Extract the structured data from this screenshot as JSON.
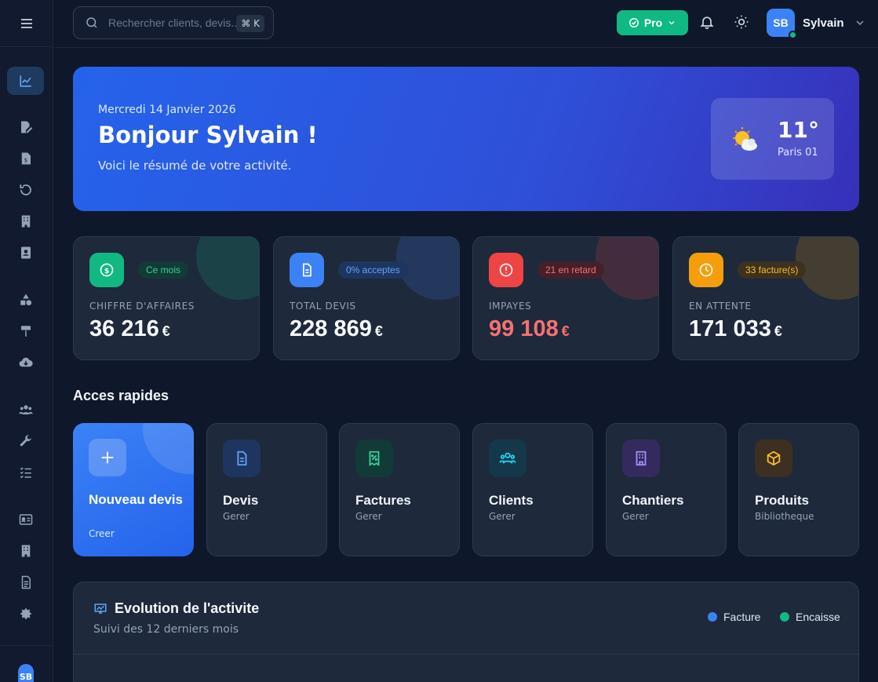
{
  "search": {
    "placeholder": "Rechercher clients, devis...",
    "shortcut": "⌘ K"
  },
  "plan": {
    "label": "Pro"
  },
  "user": {
    "initials": "SB",
    "name": "Sylvain"
  },
  "hero": {
    "date": "Mercredi 14 Janvier 2026",
    "greeting": "Bonjour Sylvain !",
    "subtitle": "Voici le résumé de votre activité.",
    "weather": {
      "temp": "11°",
      "location": "Paris 01"
    }
  },
  "stats": [
    {
      "badge": "Ce mois",
      "label": "CHIFFRE D'AFFAIRES",
      "value": "36 216",
      "currency": "€"
    },
    {
      "badge": "0% acceptes",
      "label": "TOTAL DEVIS",
      "value": "228 869",
      "currency": "€"
    },
    {
      "badge": "21 en retard",
      "label": "IMPAYES",
      "value": "99 108",
      "currency": "€"
    },
    {
      "badge": "33 facture(s)",
      "label": "EN ATTENTE",
      "value": "171 033",
      "currency": "€"
    }
  ],
  "quick": {
    "title": "Acces rapides",
    "items": [
      {
        "name": "Nouveau devis",
        "sub": "Creer"
      },
      {
        "name": "Devis",
        "sub": "Gerer"
      },
      {
        "name": "Factures",
        "sub": "Gerer"
      },
      {
        "name": "Clients",
        "sub": "Gerer"
      },
      {
        "name": "Chantiers",
        "sub": "Gerer"
      },
      {
        "name": "Produits",
        "sub": "Bibliotheque"
      }
    ]
  },
  "evolution": {
    "title": "Evolution de l'activite",
    "subtitle": "Suivi des 12 derniers mois",
    "legend": [
      "Facture",
      "Encaisse"
    ]
  },
  "sidebar": {
    "avatar": "SB"
  },
  "colors": {
    "accent": "#3b82f6",
    "success": "#10b981",
    "danger": "#ef4444",
    "warning": "#f59e0b"
  }
}
